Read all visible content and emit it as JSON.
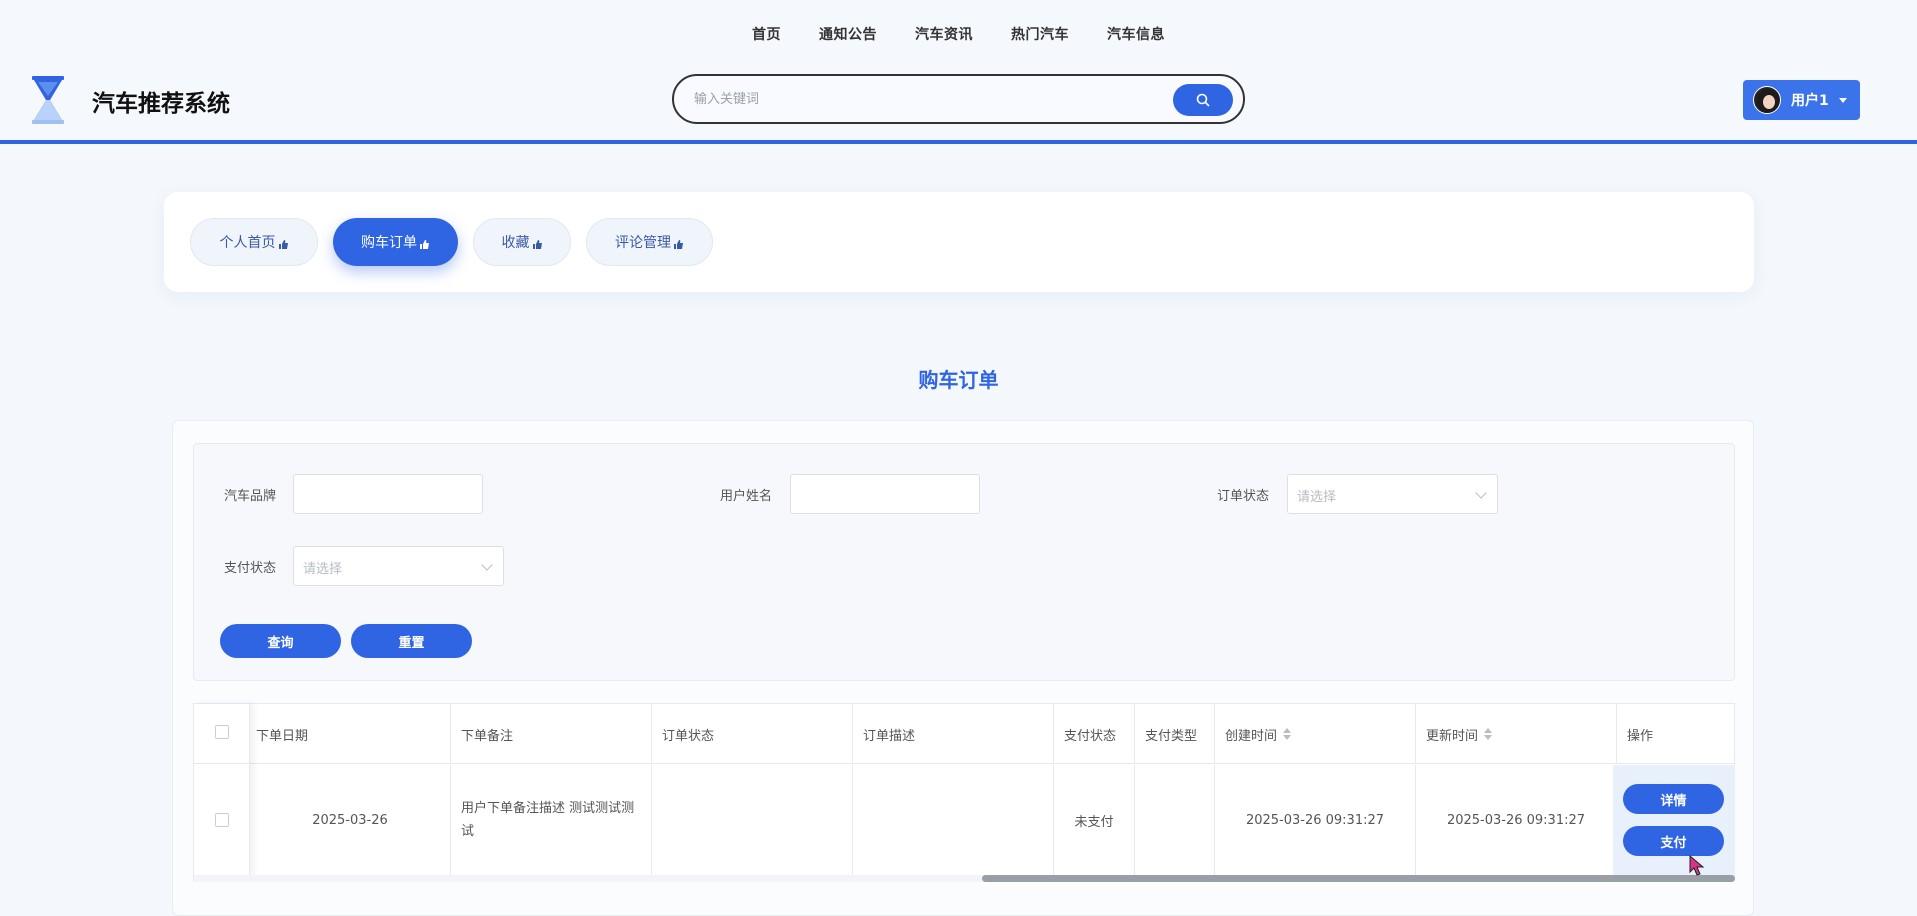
{
  "topnav": [
    "首页",
    "通知公告",
    "汽车资讯",
    "热门汽车",
    "汽车信息"
  ],
  "site": {
    "title": "汽车推荐系统"
  },
  "search": {
    "placeholder": "输入关键词"
  },
  "user": {
    "name": "用户1"
  },
  "tabs": [
    {
      "label": "个人首页",
      "active": false
    },
    {
      "label": "购车订单",
      "active": true
    },
    {
      "label": "收藏",
      "active": false
    },
    {
      "label": "评论管理",
      "active": false
    }
  ],
  "page_title": "购车订单",
  "filters": {
    "brand_label": "汽车品牌",
    "username_label": "用户姓名",
    "order_status_label": "订单状态",
    "order_status_placeholder": "请选择",
    "pay_status_label": "支付状态",
    "pay_status_placeholder": "请选择",
    "query_label": "查询",
    "reset_label": "重置"
  },
  "table": {
    "headers": [
      "下单日期",
      "下单备注",
      "订单状态",
      "订单描述",
      "支付状态",
      "支付类型",
      "创建时间",
      "更新时间",
      "操作"
    ],
    "rows": [
      {
        "date": "2025-03-26",
        "note": "用户下单备注描述 测试测试测试",
        "order_status": "",
        "order_desc": "",
        "pay_status": "未支付",
        "pay_type": "",
        "created": "2025-03-26 09:31:27",
        "updated": "2025-03-26 09:31:27",
        "actions": [
          "详情",
          "支付"
        ]
      }
    ]
  },
  "colors": {
    "accent": "#2f64e2",
    "header_border": "#2f64e2"
  }
}
